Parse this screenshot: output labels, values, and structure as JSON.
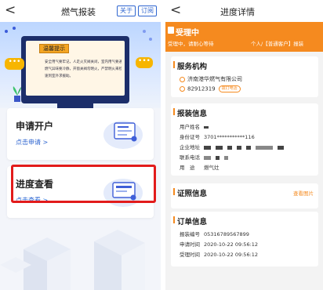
{
  "left": {
    "nav": {
      "back": "<",
      "title": "燃气报装",
      "about": "关于",
      "subscribe": "订阅"
    },
    "banner": {
      "tip_title": "温馨提示",
      "tip_lines": [
        "安全用气要牢记，人走火灭阀关闭，室内用气要通风，",
        "燃气异味要冷静，开窗关阀勿明火，严禁明火来检漏，",
        "速到室外求援助。"
      ],
      "chat_left": "•••",
      "chat_right": "•••"
    },
    "cards": [
      {
        "title": "申请开户",
        "link": "点击申请 >"
      },
      {
        "title": "进度查看",
        "link": "点击查看 >"
      }
    ]
  },
  "right": {
    "nav": {
      "back": "<",
      "title": "进度详情"
    },
    "status": {
      "title": "受理中",
      "subtitle": "受理中，请耐心等待",
      "user_type": "个人/【普通客户】报装"
    },
    "service_org": {
      "heading": "服务机构",
      "name": "济南港华燃气有限公司",
      "phone": "82912319",
      "call_label": "拨打电话"
    },
    "install_info": {
      "heading": "报装信息",
      "rows": [
        {
          "label": "用户姓名",
          "value": ""
        },
        {
          "label": "身份证号",
          "value": "3701***********116"
        },
        {
          "label": "企业地址",
          "value": ""
        },
        {
          "label": "联系电话",
          "value": ""
        },
        {
          "label": "用　途",
          "value": "燃气灶"
        }
      ]
    },
    "certificate": {
      "heading": "证照信息",
      "view": "查看图片"
    },
    "order": {
      "heading": "订单信息",
      "rows": [
        {
          "label": "报装编号",
          "value": "05316789567899"
        },
        {
          "label": "申请时间",
          "value": "2020-10-22 09:56:12"
        },
        {
          "label": "受理时间",
          "value": "2020-10-22 09:56:12"
        }
      ]
    }
  },
  "colors": {
    "accent_blue": "#2f66d0",
    "accent_orange": "#f58a1f",
    "highlight_red": "#e21b1b"
  }
}
